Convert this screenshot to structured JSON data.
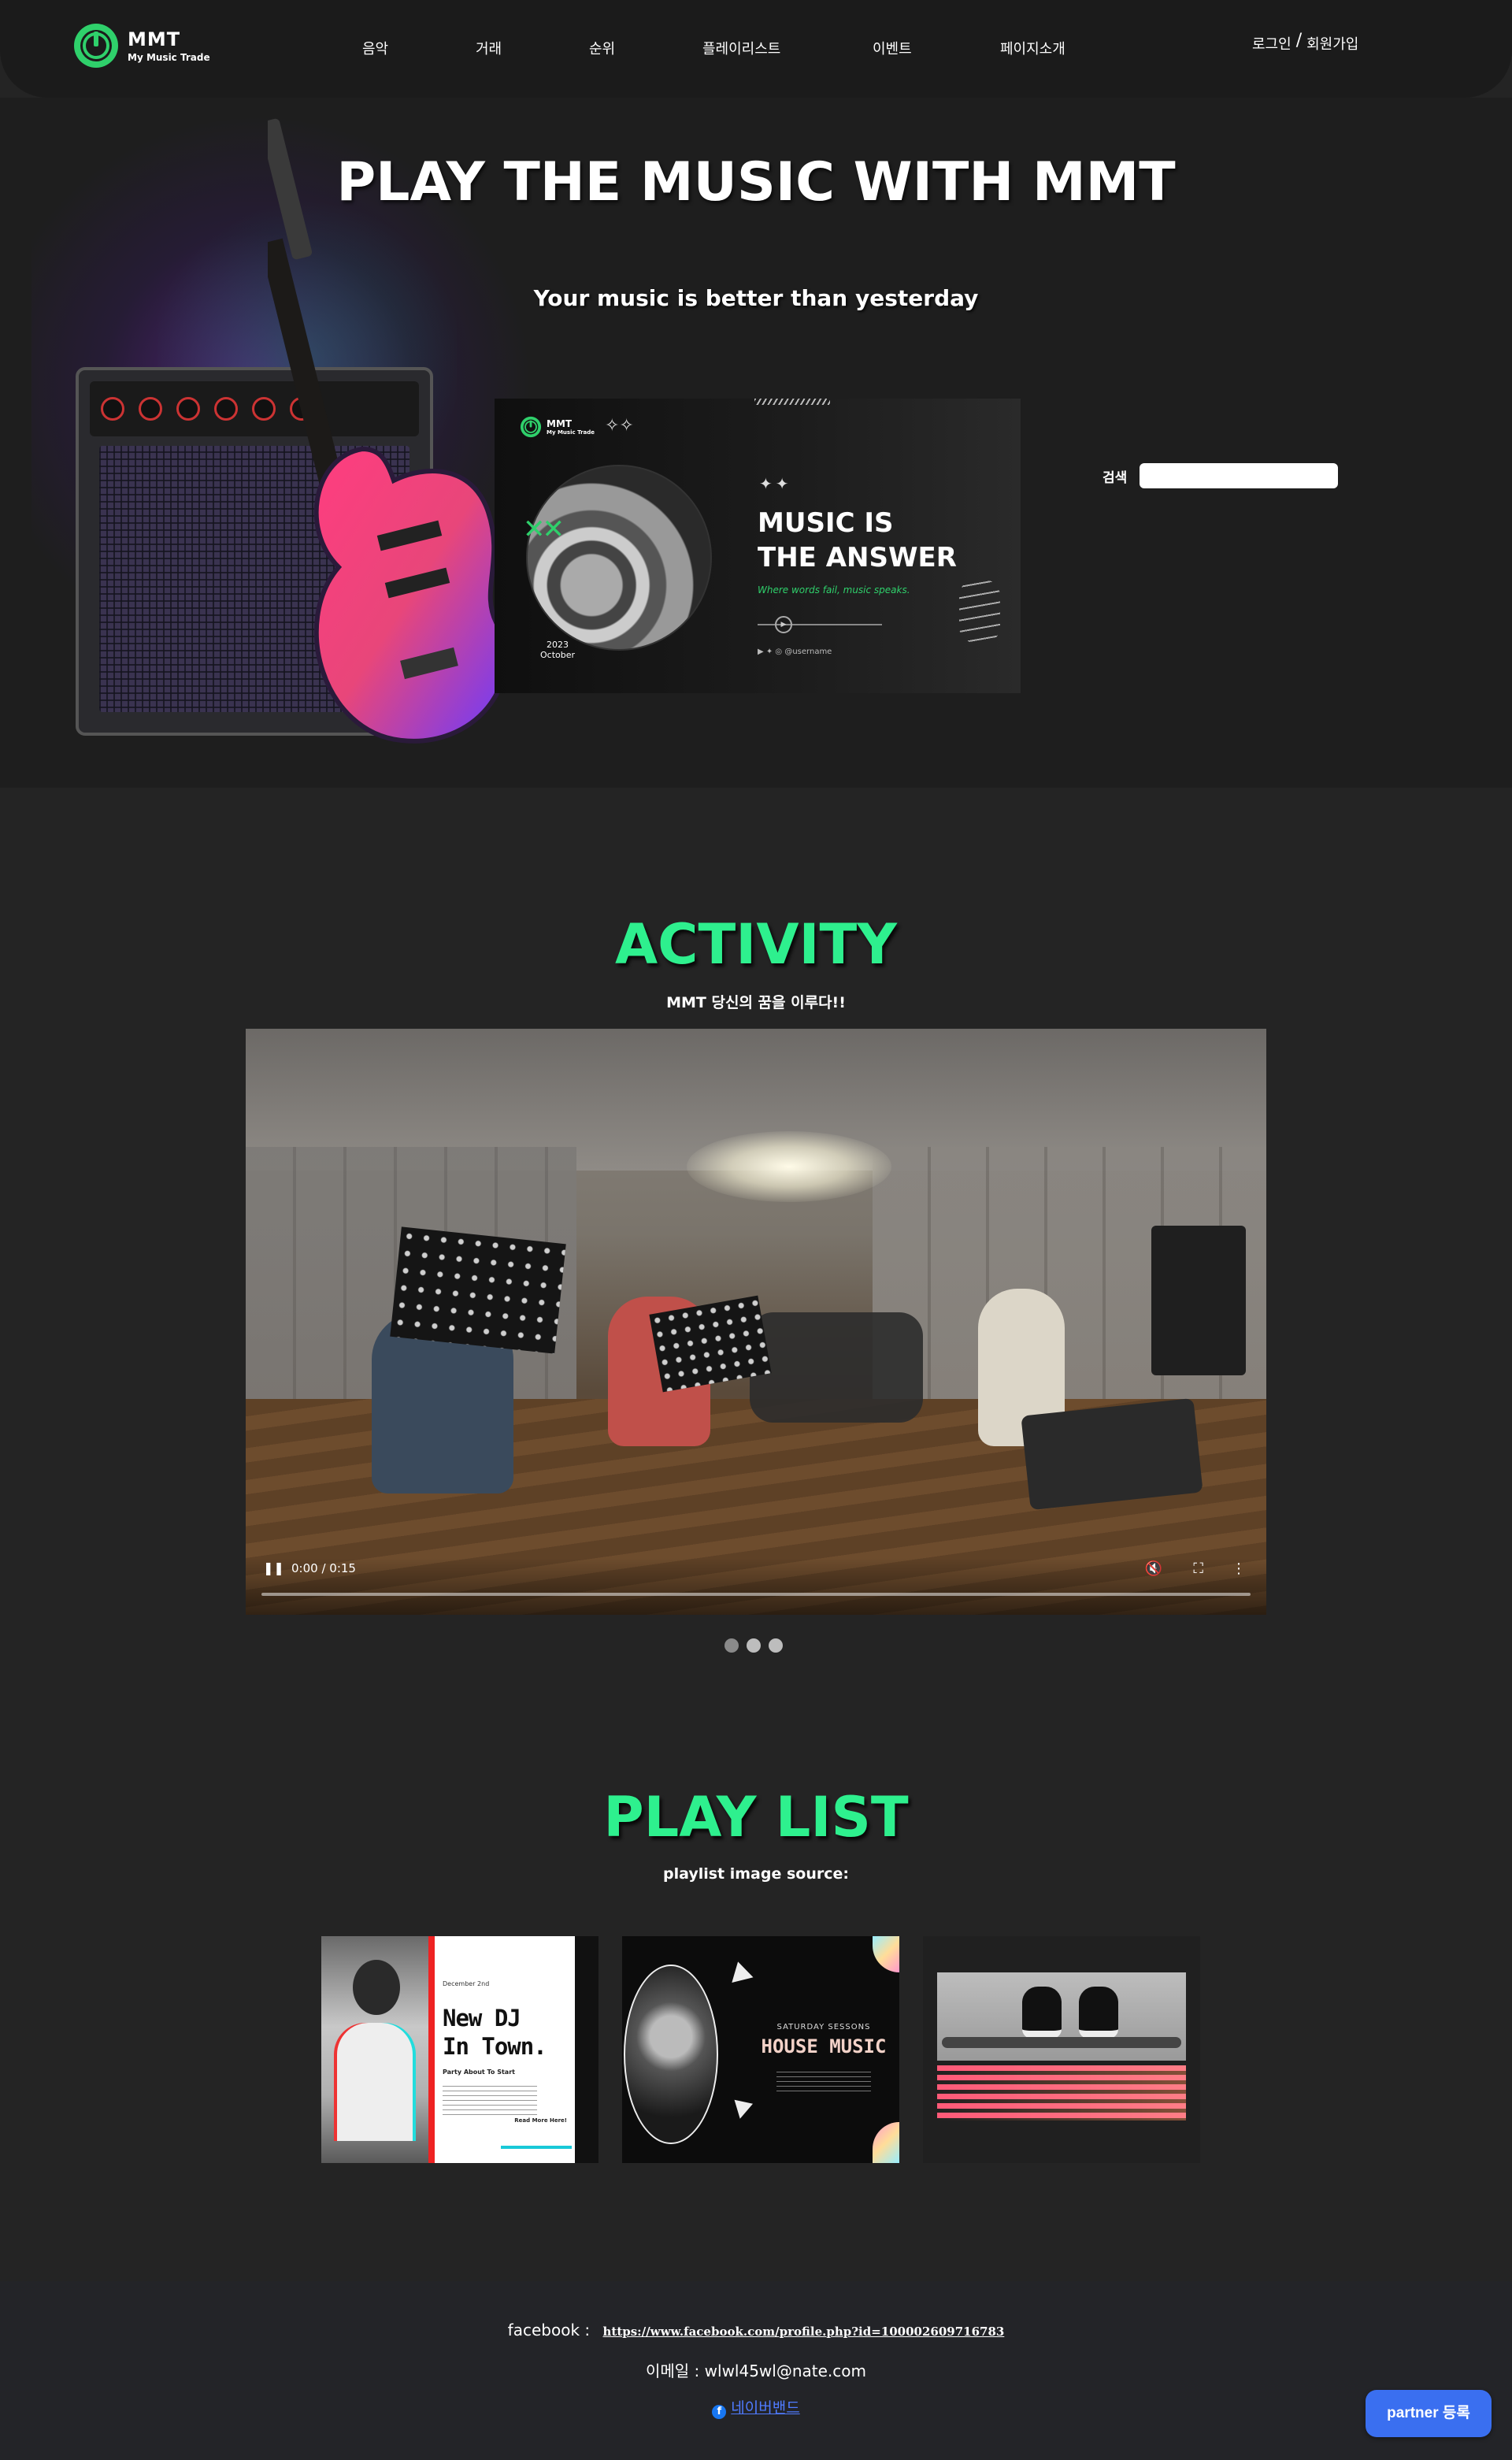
{
  "nav": {
    "logo_name": "MMT",
    "logo_sub": "My Music Trade",
    "items": [
      "음악",
      "거래",
      "순위",
      "플레이리스트",
      "이벤트",
      "페이지소개"
    ],
    "login": "로그인",
    "auth_sep": "/",
    "signup": "회원가입"
  },
  "hero": {
    "title": "PLAY THE MUSIC WITH MMT",
    "subtitle": "Your music is better than yesterday",
    "promo": {
      "logo_name": "MMT",
      "logo_sub": "My Music Trade",
      "headline_line1": "MUSIC IS",
      "headline_line2": "THE ANSWER",
      "tagline": "Where words fail, music speaks.",
      "year": "2023",
      "month": "October",
      "social_handle": "@username"
    },
    "search_label": "검색",
    "search_value": ""
  },
  "activity": {
    "title": "ACTIVITY",
    "subtitle": "MMT 당신의 꿈을 이루다!!",
    "video": {
      "time": "0:00 / 0:15",
      "progress": 0.0
    },
    "carousel_active_index": 0,
    "carousel_count": 3
  },
  "playlist": {
    "title": "PLAY LIST",
    "subtitle": "playlist image source:",
    "cards": [
      {
        "small_top": "December 2nd",
        "title_line1": "New DJ",
        "title_line2": "In Town.",
        "small_mid": "Party About To Start",
        "read_more": "Read More Here!"
      },
      {
        "small_top": "SATURDAY SESSONS",
        "title": "HOUSE MUSIC"
      },
      {}
    ]
  },
  "footer": {
    "facebook_label": "facebook :",
    "facebook_url": "https://www.facebook.com/profile.php?id=100002609716783",
    "email_label": "이메일 :",
    "email": "wlwl45wl@nate.com",
    "band_label": "네이버밴드",
    "partner_button": "partner 등록"
  },
  "colors": {
    "accent_green": "#2ef08e",
    "partner_blue": "#3a6ff0",
    "link_blue": "#4f7bff"
  }
}
